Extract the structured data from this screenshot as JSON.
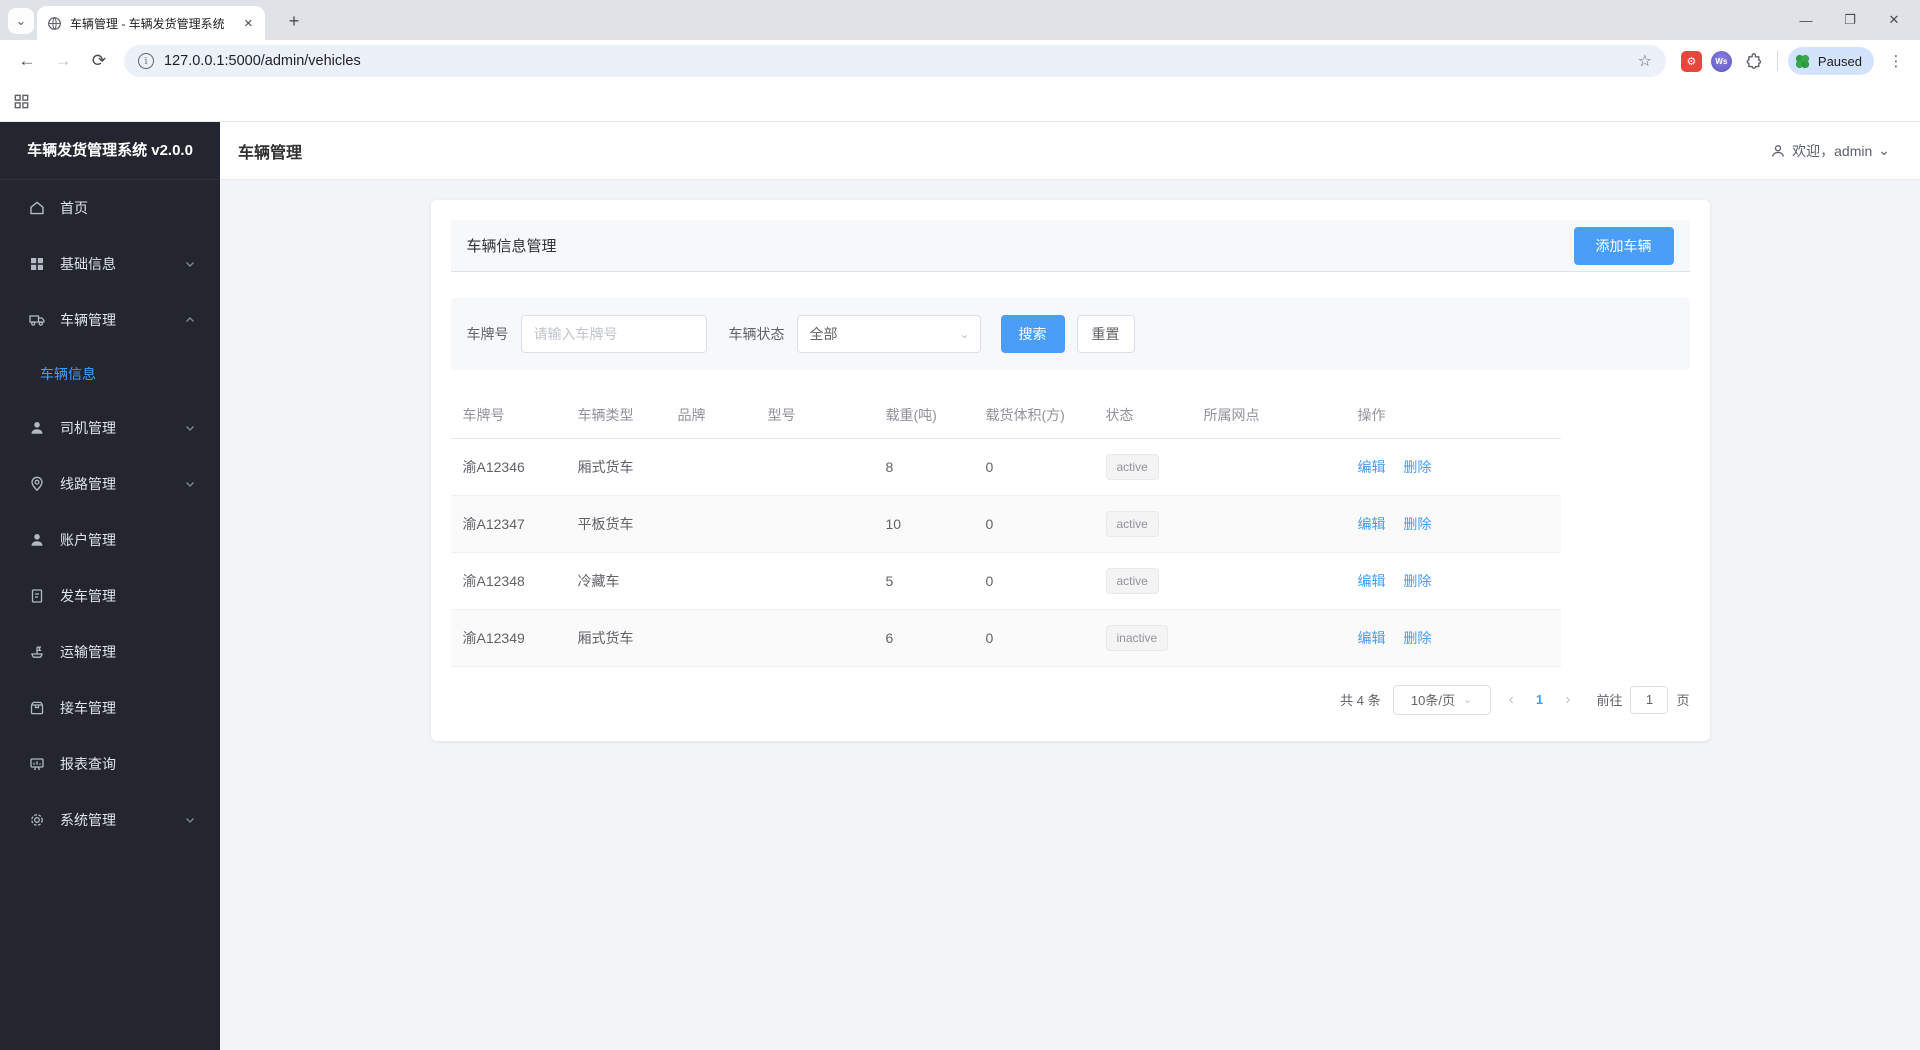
{
  "browser": {
    "tab_title": "车辆管理 - 车辆发货管理系统",
    "url": "127.0.0.1:5000/admin/vehicles",
    "profile_status": "Paused",
    "ws_badge": "Ws"
  },
  "icons": {
    "tab_chevron": "⌄",
    "tab_close": "✕",
    "new_tab": "+",
    "minimize": "—",
    "maximize": "❐",
    "window_close": "✕",
    "back": "←",
    "forward": "→",
    "reload": "⟳",
    "info": "i",
    "star": "☆",
    "ext_gear": "⚙",
    "menu_dots": "⋮",
    "select_chevron": "⌄",
    "pager_prev": "‹",
    "pager_next": "›",
    "user_chevron": "⌄"
  },
  "sidebar": {
    "title": "车辆发货管理系统 v2.0.0",
    "items": [
      {
        "label": "首页"
      },
      {
        "label": "基础信息"
      },
      {
        "label": "车辆管理"
      },
      {
        "label": "司机管理"
      },
      {
        "label": "线路管理"
      },
      {
        "label": "账户管理"
      },
      {
        "label": "发车管理"
      },
      {
        "label": "运输管理"
      },
      {
        "label": "接车管理"
      },
      {
        "label": "报表查询"
      },
      {
        "label": "系统管理"
      }
    ],
    "submenu_label": "车辆信息"
  },
  "header": {
    "title": "车辆管理",
    "welcome": "欢迎，admin"
  },
  "panel": {
    "title": "车辆信息管理",
    "add_button": "添加车辆"
  },
  "filters": {
    "plate_label": "车牌号",
    "plate_placeholder": "请输入车牌号",
    "status_label": "车辆状态",
    "status_value": "全部",
    "search_button": "搜索",
    "reset_button": "重置"
  },
  "table": {
    "columns": [
      "车牌号",
      "车辆类型",
      "品牌",
      "型号",
      "载重(吨)",
      "载货体积(方)",
      "状态",
      "所属网点",
      "操作"
    ],
    "rows": [
      {
        "plate": "渝A12346",
        "type": "厢式货车",
        "brand": "",
        "model": "",
        "load": "8",
        "volume": "0",
        "status": "active",
        "site": ""
      },
      {
        "plate": "渝A12347",
        "type": "平板货车",
        "brand": "",
        "model": "",
        "load": "10",
        "volume": "0",
        "status": "active",
        "site": ""
      },
      {
        "plate": "渝A12348",
        "type": "冷藏车",
        "brand": "",
        "model": "",
        "load": "5",
        "volume": "0",
        "status": "active",
        "site": ""
      },
      {
        "plate": "渝A12349",
        "type": "厢式货车",
        "brand": "",
        "model": "",
        "load": "6",
        "volume": "0",
        "status": "inactive",
        "site": ""
      }
    ],
    "edit_label": "编辑",
    "delete_label": "删除"
  },
  "pagination": {
    "total": "共 4 条",
    "page_size": "10条/页",
    "current_page": "1",
    "goto_label": "前往",
    "goto_value": "1",
    "page_unit": "页"
  },
  "colors": {
    "primary": "#409eff",
    "sidebar_bg": "#23262e",
    "content_bg": "#f2f4f7",
    "badge_bg": "#f4f4f5",
    "badge_text": "#909399"
  }
}
